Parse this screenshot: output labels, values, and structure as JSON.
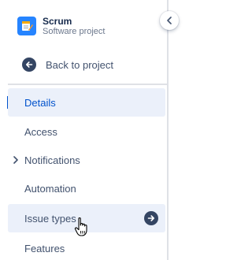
{
  "project": {
    "name": "Scrum",
    "type": "Software project",
    "avatar_icon": "notepad-pencil-icon",
    "avatar_color": "#2684ff"
  },
  "back_link": {
    "label": "Back to project",
    "icon": "arrow-left-circle-icon"
  },
  "nav": {
    "items": [
      {
        "label": "Details",
        "state": "selected"
      },
      {
        "label": "Access"
      },
      {
        "label": "Notifications",
        "icon": "chevron-right-icon"
      },
      {
        "label": "Automation"
      },
      {
        "label": "Issue types",
        "state": "hovered",
        "icon": "arrow-right-circle-icon"
      },
      {
        "label": "Features"
      }
    ]
  },
  "colors": {
    "selected_text": "#0052cc",
    "selected_background": "#ebf0fa",
    "text": "#42526e",
    "divider": "#dfe1e6"
  }
}
